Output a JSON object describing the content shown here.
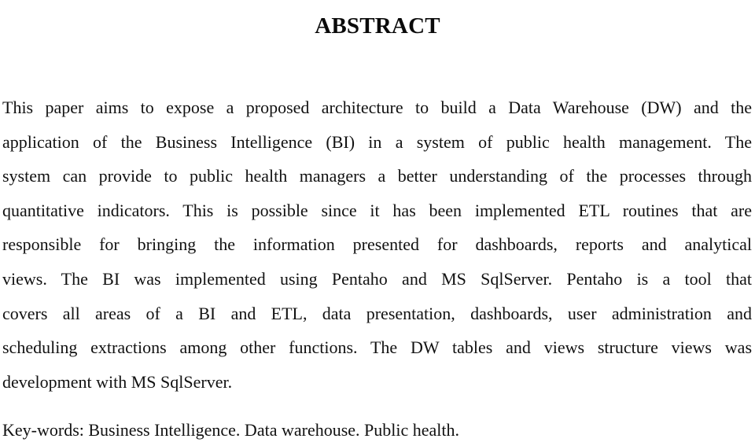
{
  "document": {
    "title": "ABSTRACT",
    "abstract_lines": [
      "This paper aims to expose a proposed architecture to build a Data Warehouse (DW) and the",
      "application of the Business Intelligence (BI) in a system of public health management. The",
      "system can provide to public health managers a better understanding of the processes through",
      "quantitative indicators. This is possible since it has been implemented ETL routines that are",
      "responsible for bringing the information presented for dashboards, reports and analytical",
      "views. The BI was implemented using Pentaho and MS SqlServer. Pentaho is a tool that",
      "covers all areas of a BI and ETL, data presentation, dashboards, user administration and",
      "scheduling extractions among other functions. The DW tables and views structure views was",
      "development with MS SqlServer."
    ],
    "keywords": "Key-words: Business Intelligence. Data warehouse. Public health."
  }
}
